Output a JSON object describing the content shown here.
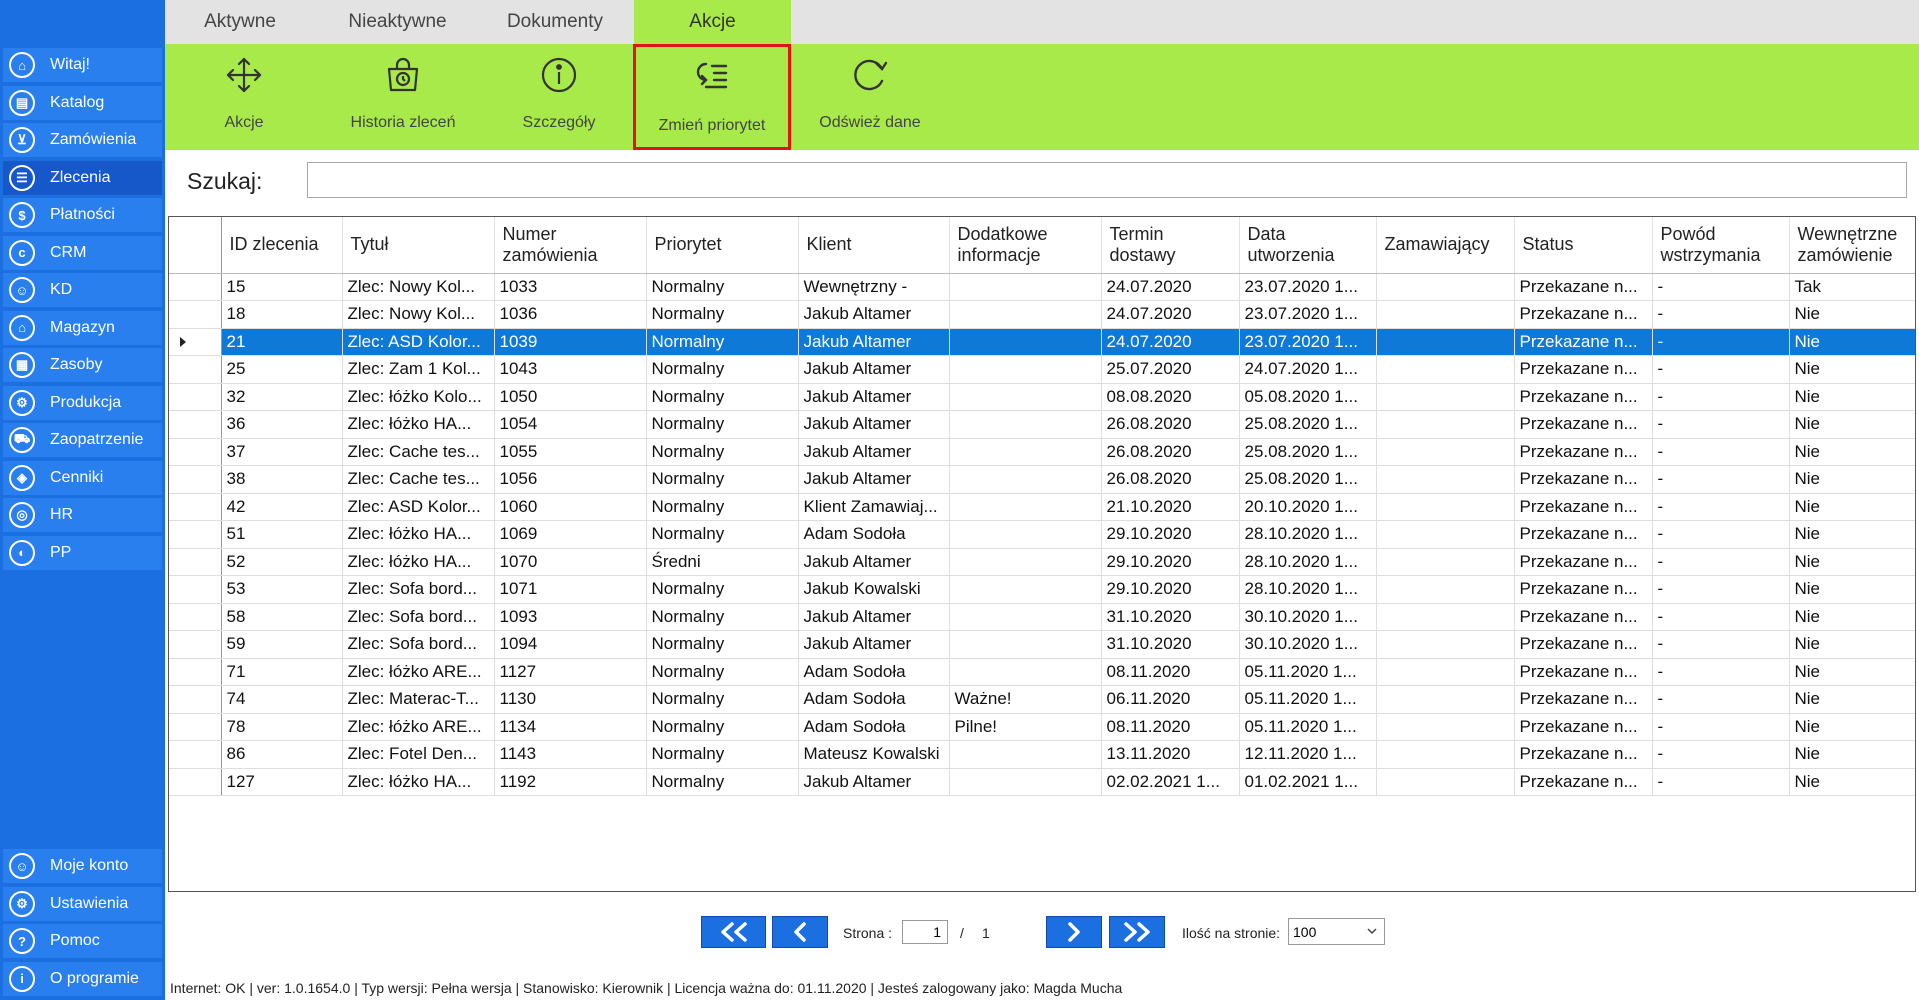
{
  "sidebar": {
    "items": [
      {
        "label": "Witaj!",
        "icon": "home-icon",
        "glyph": "⌂"
      },
      {
        "label": "Katalog",
        "icon": "book-icon",
        "glyph": "▤"
      },
      {
        "label": "Zamówienia",
        "icon": "cart-icon",
        "glyph": "⊻"
      },
      {
        "label": "Zlecenia",
        "icon": "list-icon",
        "glyph": "☰"
      },
      {
        "label": "Płatności",
        "icon": "dollar-icon",
        "glyph": "$"
      },
      {
        "label": "CRM",
        "icon": "crm-icon",
        "glyph": "c"
      },
      {
        "label": "KD",
        "icon": "user-icon",
        "glyph": "☺"
      },
      {
        "label": "Magazyn",
        "icon": "warehouse-icon",
        "glyph": "⌂"
      },
      {
        "label": "Zasoby",
        "icon": "resources-icon",
        "glyph": "▦"
      },
      {
        "label": "Produkcja",
        "icon": "production-icon",
        "glyph": "⚙"
      },
      {
        "label": "Zaopatrzenie",
        "icon": "truck-icon",
        "glyph": "⛟"
      },
      {
        "label": "Cenniki",
        "icon": "tag-icon",
        "glyph": "◈"
      },
      {
        "label": "HR",
        "icon": "hr-icon",
        "glyph": "◎"
      },
      {
        "label": "PP",
        "icon": "pp-icon",
        "glyph": "◐"
      }
    ],
    "bottom_items": [
      {
        "label": "Moje konto",
        "icon": "account-icon",
        "glyph": "☺"
      },
      {
        "label": "Ustawienia",
        "icon": "settings-icon",
        "glyph": "⚙"
      },
      {
        "label": "Pomoc",
        "icon": "help-icon",
        "glyph": "?"
      },
      {
        "label": "O programie",
        "icon": "info-icon",
        "glyph": "i"
      }
    ]
  },
  "tabs": [
    {
      "label": "Aktywne"
    },
    {
      "label": "Nieaktywne"
    },
    {
      "label": "Dokumenty"
    },
    {
      "label": "Akcje"
    }
  ],
  "ribbon": {
    "buttons": [
      {
        "label": "Akcje",
        "icon": "move-arrows-icon"
      },
      {
        "label": "Historia zleceń",
        "icon": "history-bag-icon"
      },
      {
        "label": "Szczegóły",
        "icon": "info-circle-icon"
      },
      {
        "label": "Zmień priorytet",
        "icon": "priority-list-icon"
      },
      {
        "label": "Odśwież dane",
        "icon": "refresh-icon"
      }
    ]
  },
  "search": {
    "label": "Szukaj:",
    "value": ""
  },
  "grid": {
    "columns": [
      "ID zlecenia",
      "Tytuł",
      "Numer zamówienia",
      "Priorytet",
      "Klient",
      "Dodatkowe informacje",
      "Termin dostawy",
      "Data utworzenia",
      "Zamawiający",
      "Status",
      "Powód wstrzymania",
      "Wewnętrzne zamówienie"
    ],
    "rows": [
      [
        "15",
        "Zlec: Nowy Kol...",
        "1033",
        "Normalny",
        "Wewnętrzny -",
        "",
        "24.07.2020",
        "23.07.2020 1...",
        "",
        "Przekazane n...",
        "-",
        "Tak"
      ],
      [
        "18",
        "Zlec: Nowy Kol...",
        "1036",
        "Normalny",
        "Jakub  Altamer",
        "",
        "24.07.2020",
        "23.07.2020 1...",
        "",
        "Przekazane n...",
        "-",
        "Nie"
      ],
      [
        "21",
        "Zlec: ASD Kolor...",
        "1039",
        "Normalny",
        "Jakub  Altamer",
        "",
        "24.07.2020",
        "23.07.2020 1...",
        "",
        "Przekazane n...",
        "-",
        "Nie"
      ],
      [
        "25",
        "Zlec: Zam 1 Kol...",
        "1043",
        "Normalny",
        "Jakub  Altamer",
        "",
        "25.07.2020",
        "24.07.2020 1...",
        "",
        "Przekazane n...",
        "-",
        "Nie"
      ],
      [
        "32",
        "Zlec: łóżko Kolo...",
        "1050",
        "Normalny",
        "Jakub  Altamer",
        "",
        "08.08.2020",
        "05.08.2020 1...",
        "",
        "Przekazane n...",
        "-",
        "Nie"
      ],
      [
        "36",
        "Zlec: łóżko HA...",
        "1054",
        "Normalny",
        "Jakub  Altamer",
        "",
        "26.08.2020",
        "25.08.2020 1...",
        "",
        "Przekazane n...",
        "-",
        "Nie"
      ],
      [
        "37",
        "Zlec: Cache tes...",
        "1055",
        "Normalny",
        "Jakub  Altamer",
        "",
        "26.08.2020",
        "25.08.2020 1...",
        "",
        "Przekazane n...",
        "-",
        "Nie"
      ],
      [
        "38",
        "Zlec: Cache tes...",
        "1056",
        "Normalny",
        "Jakub  Altamer",
        "",
        "26.08.2020",
        "25.08.2020 1...",
        "",
        "Przekazane n...",
        "-",
        "Nie"
      ],
      [
        "42",
        "Zlec: ASD Kolor...",
        "1060",
        "Normalny",
        "Klient Zamawiaj...",
        "",
        "21.10.2020",
        "20.10.2020 1...",
        "",
        "Przekazane n...",
        "-",
        "Nie"
      ],
      [
        "51",
        "Zlec: łóżko HA...",
        "1069",
        "Normalny",
        "Adam Sodoła",
        "",
        "29.10.2020",
        "28.10.2020 1...",
        "",
        "Przekazane n...",
        "-",
        "Nie"
      ],
      [
        "52",
        "Zlec: łóżko HA...",
        "1070",
        "Średni",
        "Jakub  Altamer",
        "",
        "29.10.2020",
        "28.10.2020 1...",
        "",
        "Przekazane n...",
        "-",
        "Nie"
      ],
      [
        "53",
        "Zlec: Sofa bord...",
        "1071",
        "Normalny",
        "Jakub Kowalski",
        "",
        "29.10.2020",
        "28.10.2020 1...",
        "",
        "Przekazane n...",
        "-",
        "Nie"
      ],
      [
        "58",
        "Zlec: Sofa bord...",
        "1093",
        "Normalny",
        "Jakub  Altamer",
        "",
        "31.10.2020",
        "30.10.2020 1...",
        "",
        "Przekazane n...",
        "-",
        "Nie"
      ],
      [
        "59",
        "Zlec: Sofa bord...",
        "1094",
        "Normalny",
        "Jakub  Altamer",
        "",
        "31.10.2020",
        "30.10.2020 1...",
        "",
        "Przekazane n...",
        "-",
        "Nie"
      ],
      [
        "71",
        "Zlec: łóżko ARE...",
        "1127",
        "Normalny",
        "Adam Sodoła",
        "",
        "08.11.2020",
        "05.11.2020 1...",
        "",
        "Przekazane n...",
        "-",
        "Nie"
      ],
      [
        "74",
        "Zlec: Materac-T...",
        "1130",
        "Normalny",
        "Adam Sodoła",
        "Ważne!",
        "06.11.2020",
        "05.11.2020 1...",
        "",
        "Przekazane n...",
        "-",
        "Nie"
      ],
      [
        "78",
        "Zlec: łóżko ARE...",
        "1134",
        "Normalny",
        "Adam Sodoła",
        "Pilne!",
        "08.11.2020",
        "05.11.2020 1...",
        "",
        "Przekazane n...",
        "-",
        "Nie"
      ],
      [
        "86",
        "Zlec: Fotel Den...",
        "1143",
        "Normalny",
        "Mateusz Kowalski",
        "",
        "13.11.2020",
        "12.11.2020 1...",
        "",
        "Przekazane n...",
        "-",
        "Nie"
      ],
      [
        "127",
        "Zlec: łóżko HA...",
        "1192",
        "Normalny",
        "Jakub  Altamer",
        "",
        "02.02.2021 1...",
        "01.02.2021 1...",
        "",
        "Przekazane n...",
        "-",
        "Nie"
      ]
    ],
    "selected_row": 2
  },
  "pager": {
    "page_label": "Strona :",
    "current_page": "1",
    "separator": "/",
    "total_pages": "1",
    "per_page_label": "Ilość na stronie:",
    "per_page_value": "100"
  },
  "status": {
    "text": "Internet: OK  |   ver: 1.0.1654.0   |   Typ wersji: Pełna wersja   |   Stanowisko: Kierownik   |   Licencja ważna do: 01.11.2020   |   Jesteś zalogowany jako: Magda Mucha"
  },
  "colors": {
    "sidebar": "#1b6fe0",
    "ribbon": "#a7ea4a",
    "selected_row": "#0f79d7",
    "highlight_border": "#e01414"
  }
}
